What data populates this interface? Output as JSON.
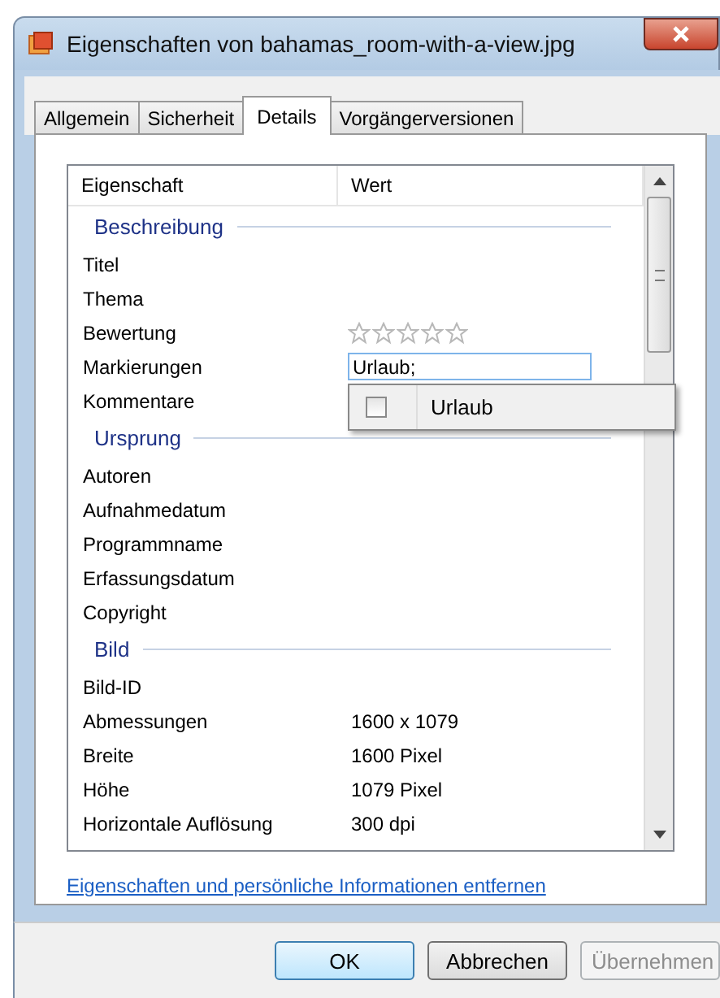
{
  "window": {
    "title": "Eigenschaften von bahamas_room-with-a-view.jpg"
  },
  "tabs": [
    {
      "label": "Allgemein",
      "selected": false
    },
    {
      "label": "Sicherheit",
      "selected": false
    },
    {
      "label": "Details",
      "selected": true
    },
    {
      "label": "Vorgängerversionen",
      "selected": false
    }
  ],
  "table": {
    "columns": [
      "Eigenschaft",
      "Wert"
    ],
    "rows": [
      {
        "kind": "group",
        "label": "Beschreibung"
      },
      {
        "kind": "property",
        "name": "Titel"
      },
      {
        "kind": "property",
        "name": "Thema"
      },
      {
        "kind": "rating",
        "name": "Bewertung",
        "stars": 0
      },
      {
        "kind": "edit",
        "name": "Markierungen",
        "value": "Urlaub;",
        "suggestions": [
          {
            "label": "Urlaub",
            "checked": false
          }
        ]
      },
      {
        "kind": "property",
        "name": "Kommentare"
      },
      {
        "kind": "group",
        "label": "Ursprung"
      },
      {
        "kind": "property",
        "name": "Autoren"
      },
      {
        "kind": "property",
        "name": "Aufnahmedatum"
      },
      {
        "kind": "property",
        "name": "Programmname"
      },
      {
        "kind": "property",
        "name": "Erfassungsdatum"
      },
      {
        "kind": "property",
        "name": "Copyright"
      },
      {
        "kind": "group",
        "label": "Bild"
      },
      {
        "kind": "property",
        "name": "Bild-ID"
      },
      {
        "kind": "property",
        "name": "Abmessungen",
        "value": "1600 x 1079"
      },
      {
        "kind": "property",
        "name": "Breite",
        "value": "1600 Pixel"
      },
      {
        "kind": "property",
        "name": "Höhe",
        "value": "1079 Pixel"
      },
      {
        "kind": "property",
        "name": "Horizontale Auflösung",
        "value": "300 dpi"
      }
    ]
  },
  "link": "Eigenschaften und persönliche Informationen entfernen",
  "buttons": [
    {
      "label": "OK",
      "kind": "default",
      "disabled": false
    },
    {
      "label": "Abbrechen",
      "kind": "normal",
      "disabled": false
    },
    {
      "label": "Übernehmen",
      "kind": "normal",
      "disabled": true
    }
  ]
}
